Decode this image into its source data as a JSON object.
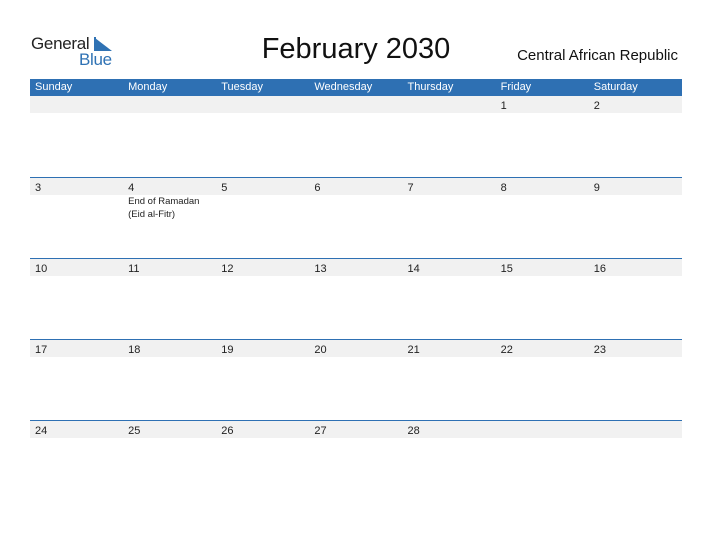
{
  "logo": {
    "general": "General",
    "blue": "Blue",
    "brand_color": "#2f72b4"
  },
  "header": {
    "title": "February 2030",
    "country": "Central African Republic"
  },
  "calendar": {
    "accent_color": "#2e70b3",
    "weekdays": [
      "Sunday",
      "Monday",
      "Tuesday",
      "Wednesday",
      "Thursday",
      "Friday",
      "Saturday"
    ],
    "weeks": [
      {
        "days": [
          {
            "num": ""
          },
          {
            "num": ""
          },
          {
            "num": ""
          },
          {
            "num": ""
          },
          {
            "num": ""
          },
          {
            "num": "1"
          },
          {
            "num": "2"
          }
        ]
      },
      {
        "days": [
          {
            "num": "3"
          },
          {
            "num": "4",
            "event_line1": "End of Ramadan",
            "event_line2": "(Eid al-Fitr)"
          },
          {
            "num": "5"
          },
          {
            "num": "6"
          },
          {
            "num": "7"
          },
          {
            "num": "8"
          },
          {
            "num": "9"
          }
        ]
      },
      {
        "days": [
          {
            "num": "10"
          },
          {
            "num": "11"
          },
          {
            "num": "12"
          },
          {
            "num": "13"
          },
          {
            "num": "14"
          },
          {
            "num": "15"
          },
          {
            "num": "16"
          }
        ]
      },
      {
        "days": [
          {
            "num": "17"
          },
          {
            "num": "18"
          },
          {
            "num": "19"
          },
          {
            "num": "20"
          },
          {
            "num": "21"
          },
          {
            "num": "22"
          },
          {
            "num": "23"
          }
        ]
      },
      {
        "days": [
          {
            "num": "24"
          },
          {
            "num": "25"
          },
          {
            "num": "26"
          },
          {
            "num": "27"
          },
          {
            "num": "28"
          },
          {
            "num": ""
          },
          {
            "num": ""
          }
        ]
      }
    ]
  }
}
